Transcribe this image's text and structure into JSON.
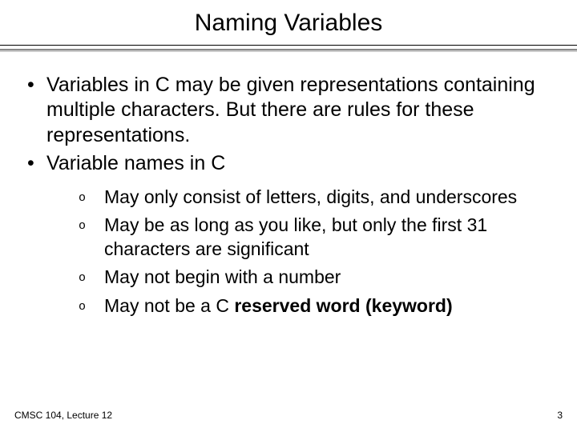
{
  "title": "Naming Variables",
  "bullets": [
    "Variables in C may be given representations containing multiple characters.  But there are rules for these representations.",
    "Variable names in C"
  ],
  "sub_marker": "o",
  "sub_bullets": [
    {
      "plain": "May only consist of letters, digits, and underscores",
      "bold": ""
    },
    {
      "plain": "May be as long as you like, but only the first 31 characters are significant",
      "bold": ""
    },
    {
      "plain": "May not begin with a number",
      "bold": ""
    },
    {
      "plain": "May not be a C ",
      "bold": "reserved word (keyword)"
    }
  ],
  "footer": {
    "left": "CMSC 104, Lecture 12",
    "right": "3"
  }
}
